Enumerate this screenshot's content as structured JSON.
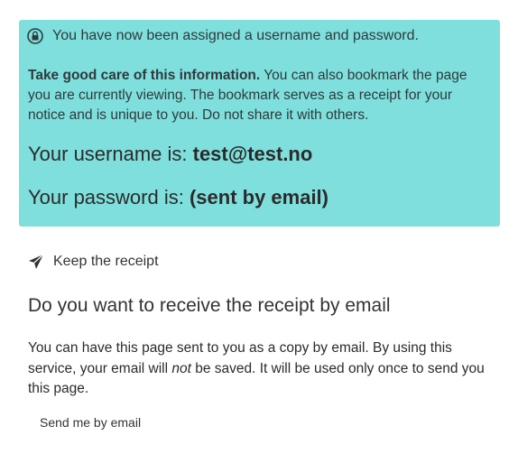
{
  "notice": {
    "header": "You have now been assigned a username and password.",
    "body_strong": "Take good care of this information.",
    "body_rest": " You can also bookmark the page you are currently viewing. The bookmark serves as a receipt for your notice and is unique to you. Do not share it with others.",
    "username_label": "Your username is: ",
    "username_value": "test@test.no",
    "password_label": "Your password is: ",
    "password_value": "(sent by email)",
    "icon": "lock-icon",
    "background_color": "#7edfdc"
  },
  "receipt": {
    "heading": "Keep the receipt",
    "icon": "paper-plane-icon",
    "title": "Do you want to receive the receipt by email",
    "text_before": "You can have this page sent to you as a copy by email. By using this service, your email will ",
    "text_emphasis": "not",
    "text_after": " be saved. It will be used only once to send you this page.",
    "button_label": "Send me by email"
  }
}
